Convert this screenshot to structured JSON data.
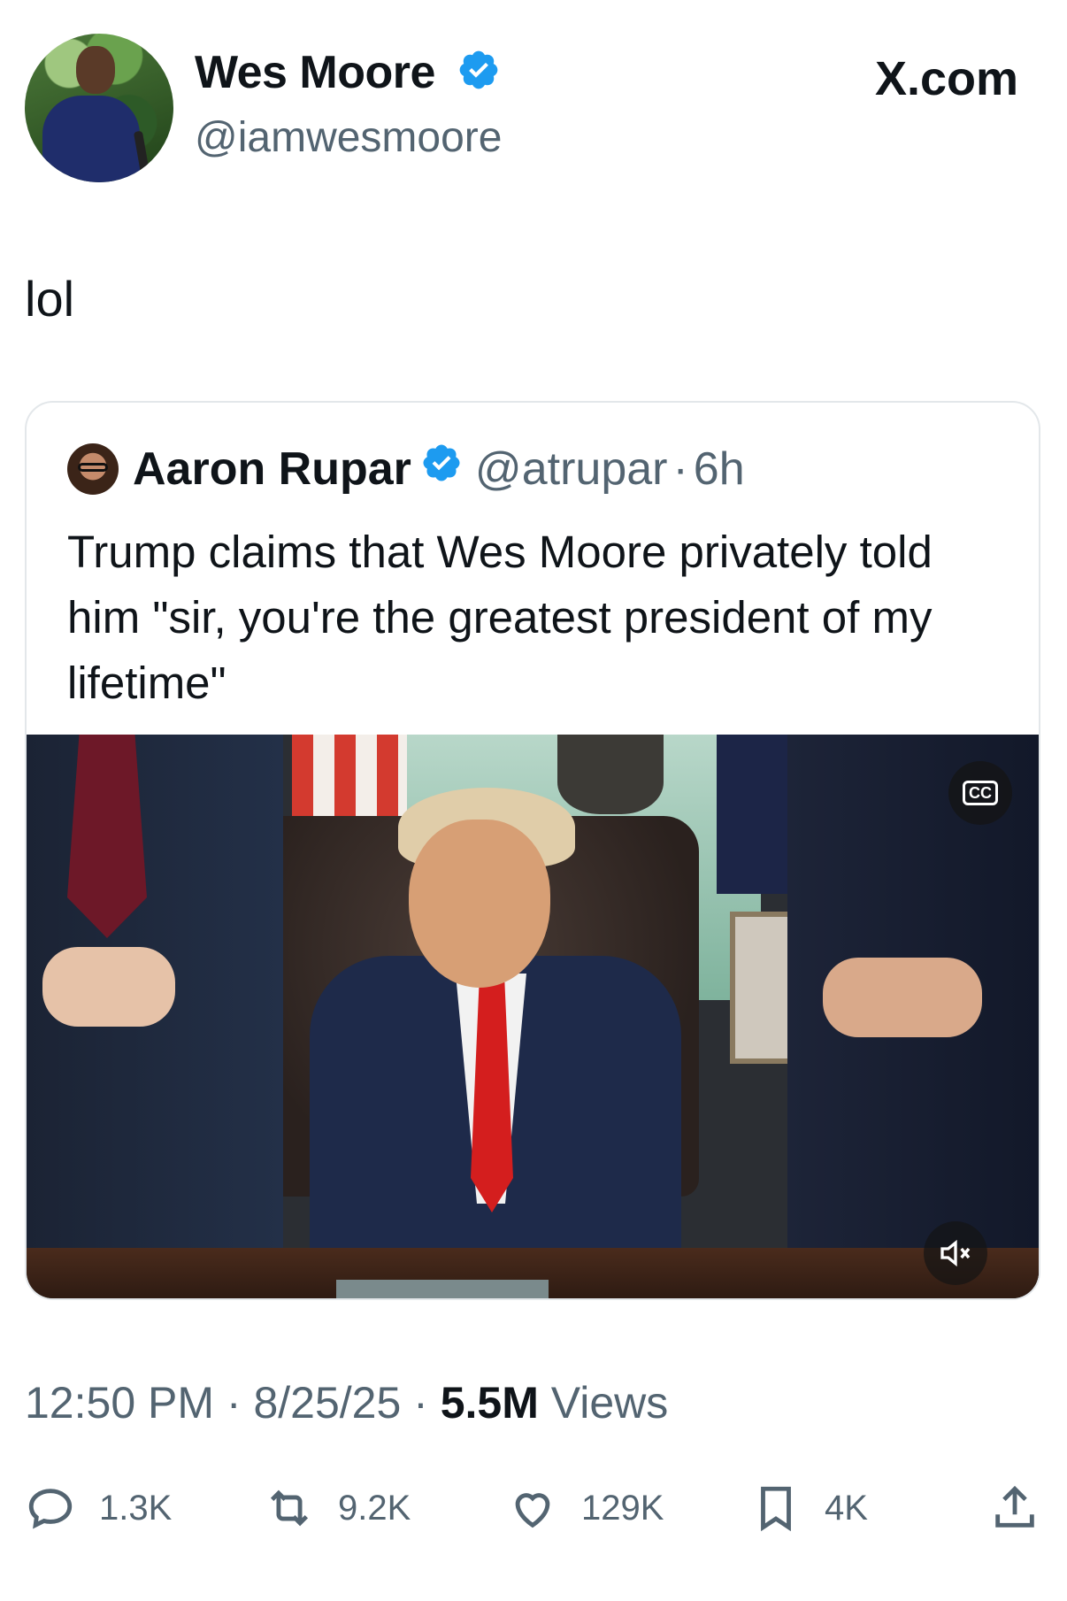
{
  "post": {
    "author_name": "Wes Moore",
    "author_handle": "@iamwesmoore",
    "brand": "X.com",
    "text": "lol",
    "timestamp": "12:50 PM · 8/25/25 · ",
    "views_count": "5.5M",
    "views_label": " Views"
  },
  "quote": {
    "author_name": "Aaron Rupar",
    "author_handle": "@atrupar",
    "separator": "·",
    "time": "6h",
    "text": "Trump claims that Wes Moore privately told him \"sir, you're the greatest president of my lifetime\"",
    "media": {
      "cc_label": "CC"
    }
  },
  "actions": {
    "replies": "1.3K",
    "reposts": "9.2K",
    "likes": "129K",
    "bookmarks": "4K"
  },
  "colors": {
    "verified": "#1d9bf0",
    "muted_text": "#536471",
    "primary_text": "#0f1419"
  },
  "icons": [
    "verified-badge-icon",
    "closed-captions-icon",
    "mute-icon",
    "reply-icon",
    "repost-icon",
    "like-icon",
    "bookmark-icon",
    "share-icon"
  ]
}
